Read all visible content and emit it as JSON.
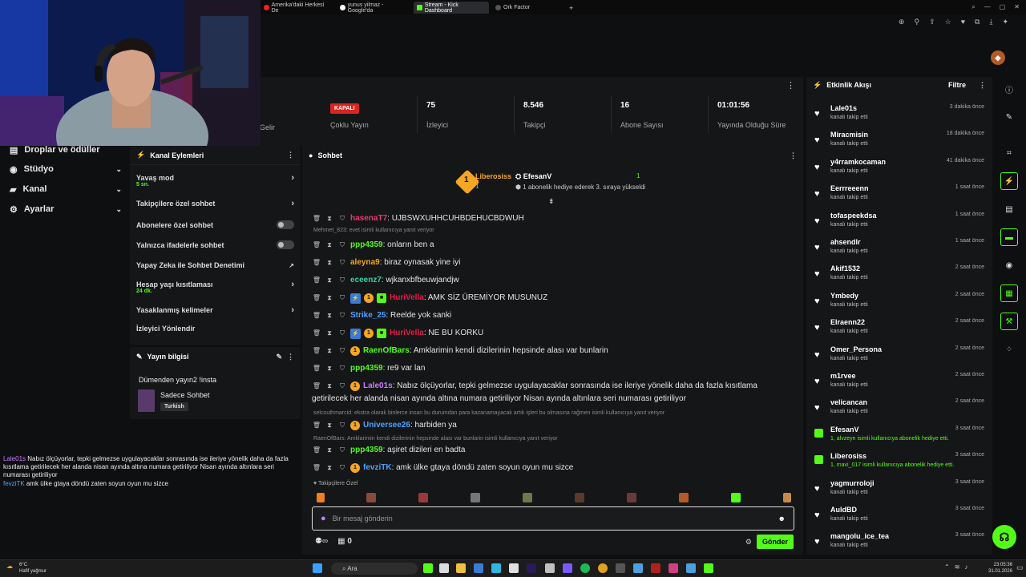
{
  "browser": {
    "tabs": [
      {
        "label": "Amerika'daki Herkesi De",
        "color": "#e22"
      },
      {
        "label": "yunus yilmaz - Google'da",
        "color": "#fff"
      },
      {
        "label": "Stream - Kick Dashboard",
        "color": "#53fc18"
      },
      {
        "label": "Ork Factor",
        "color": "#333"
      }
    ],
    "new_tab": "+"
  },
  "stats": {
    "partial_label_1": "ik Gelir",
    "live": {
      "badge": "KAPALI",
      "label": "Çoklu Yayın"
    },
    "viewers": {
      "value": "75",
      "label": "İzleyici"
    },
    "followers": {
      "value": "8.546",
      "label": "Takipçi"
    },
    "subs": {
      "value": "16",
      "label": "Abone Sayısı"
    },
    "uptime": {
      "value": "01:01:56",
      "label": "Yayında Olduğu Süre"
    }
  },
  "leftnav": {
    "items": [
      {
        "label": "Droplar ve ödüller"
      },
      {
        "label": "Stüdyo"
      },
      {
        "label": "Kanal"
      },
      {
        "label": "Ayarlar"
      }
    ]
  },
  "channel_actions": {
    "title": "Kanal Eylemleri",
    "slow_mode": {
      "label": "Yavaş mod",
      "sub": "5 sn."
    },
    "followers_only": "Takipçilere özel sohbet",
    "subs_only": "Abonelere özel sohbet",
    "emotes_only": "Yalnızca ifadelerle sohbet",
    "ai_moderation": "Yapay Zeka ile Sohbet Denetimi",
    "account_age": {
      "label": "Hesap yaşı kısıtlaması",
      "sub": "24 dk."
    },
    "banned_words": "Yasaklanmış kelimeler",
    "viewer_redirect": "İzleyici Yönlendir"
  },
  "stream_info": {
    "title": "Yayın bilgisi",
    "stream_title": "Dümenden yayın2 !insta",
    "category": "Sadece Sohbet",
    "language": "Turkish"
  },
  "chat": {
    "title": "Sohbet",
    "pinned": {
      "top1": {
        "name": "Liberosiss",
        "count": "1"
      },
      "top2": {
        "name": "EfesanV",
        "count": "1"
      },
      "note": "1 abonelik hediye ederek 3. sıraya yükseldi"
    },
    "messages": [
      {
        "user": "hasenaT7",
        "color": "#e63b6f",
        "text": ": UJBSWXUHHCUHBDEHUCBDWUH"
      },
      {
        "reply": "Mehmet_823: evet isimli kullanıcıya yanıt veriyor"
      },
      {
        "user": "ppp4359",
        "color": "#53fc18",
        "text": ": onların ben a"
      },
      {
        "user": "aleyna9",
        "color": "#f5a623",
        "text": ": biraz oynasak yine iyi"
      },
      {
        "user": "eceenz7",
        "color": "#2fd3a0",
        "text": ": wjkanxbfbeuwjandjw"
      },
      {
        "user": "HuriVella",
        "color": "#e6194b",
        "text": ": AMK SİZ ÜREMİYOR MUSUNUZ"
      },
      {
        "user": "Strike_25",
        "color": "#4aa3ff",
        "text": ": Reelde yok sanki"
      },
      {
        "user": "HuriVella",
        "color": "#e6194b",
        "text": ": NE BU KORKU"
      },
      {
        "user": "RaenOfBars",
        "color": "#53fc18",
        "text": ": Amklarimin kendi dizilerinin hepsinde alası var bunlarin"
      },
      {
        "user": "ppp4359",
        "color": "#53fc18",
        "text": ": re9 var lan"
      },
      {
        "user": "Lale01s",
        "color": "#c77dff",
        "text": ": Nabız ölçüyorlar, tepki gelmezse uygulayacaklar sonrasında ise ileriye yönelik daha da fazla kısıtlama"
      },
      {
        "cont": "getirilecek her alanda nisan ayında altına numara getiriliyor Nisan ayında altınlara seri numarası getiriliyor"
      },
      {
        "reply": "selcouthmarcid: ekstra olarak binlerce insan bu durumdan para kazanamayacak artık işleri bu olmasına rağmen isimli kullanıcıya yanıt veriyor"
      },
      {
        "user": "Universee26",
        "color": "#4aa3ff",
        "text": ": harbiden ya"
      },
      {
        "reply": "RaenOfBars: Amklarimin kendi dizilerinin hepsinde alası var bunlarin isimli kullanıcıya yanıt veriyor"
      },
      {
        "user": "ppp4359",
        "color": "#53fc18",
        "text": ": aşiret dizileri en badta"
      },
      {
        "user": "fevziTK",
        "color": "#4aa3ff",
        "text": ": amk ülke gtaya döndü zaten soyun oyun mu sizce"
      }
    ],
    "followers_emotes_label": "Takipçilere Özel",
    "input_placeholder": "Bir mesaj gönderin",
    "points": "0",
    "send": "Gönder"
  },
  "feed": {
    "title": "Etkinlik Akışı",
    "filter": "Filtre",
    "items": [
      {
        "name": "Lale01s",
        "sub": "kanalı takip etti",
        "time": "3 dakika önce",
        "type": "follow"
      },
      {
        "name": "Miracmisin",
        "sub": "kanalı takip etti",
        "time": "18 dakika önce",
        "type": "follow"
      },
      {
        "name": "y4rramkocaman",
        "sub": "kanalı takip etti",
        "time": "41 dakika önce",
        "type": "follow"
      },
      {
        "name": "Eerrreeenn",
        "sub": "kanalı takip etti",
        "time": "1 saat önce",
        "type": "follow"
      },
      {
        "name": "tofaspeekdsa",
        "sub": "kanalı takip etti",
        "time": "1 saat önce",
        "type": "follow"
      },
      {
        "name": "ahsendlr",
        "sub": "kanalı takip etti",
        "time": "1 saat önce",
        "type": "follow"
      },
      {
        "name": "Akif1532",
        "sub": "kanalı takip etti",
        "time": "2 saat önce",
        "type": "follow"
      },
      {
        "name": "Ymbedy",
        "sub": "kanalı takip etti",
        "time": "2 saat önce",
        "type": "follow"
      },
      {
        "name": "Elraenn22",
        "sub": "kanalı takip etti",
        "time": "2 saat önce",
        "type": "follow"
      },
      {
        "name": "Omer_Persona",
        "sub": "kanalı takip etti",
        "time": "2 saat önce",
        "type": "follow"
      },
      {
        "name": "m1rvee",
        "sub": "kanalı takip etti",
        "time": "2 saat önce",
        "type": "follow"
      },
      {
        "name": "velicancan",
        "sub": "kanalı takip etti",
        "time": "2 saat önce",
        "type": "follow"
      },
      {
        "name": "EfesanV",
        "sub": "1, alvzeyn isimli kullanıcıya abonelik hediye etti.",
        "time": "3 saat önce",
        "type": "gift"
      },
      {
        "name": "Liberosiss",
        "sub": "1, mavi_017 isimli kullanıcıya abonelik hediye etti.",
        "time": "3 saat önce",
        "type": "gift"
      },
      {
        "name": "yagmurroloji",
        "sub": "kanalı takip etti",
        "time": "3 saat önce",
        "type": "follow"
      },
      {
        "name": "AuldBD",
        "sub": "kanalı takip etti",
        "time": "3 saat önce",
        "type": "follow"
      },
      {
        "name": "mangolu_ice_tea",
        "sub": "kanalı takip etti",
        "time": "3 saat önce",
        "type": "follow"
      }
    ]
  },
  "overlay": [
    {
      "user": "Lale01s",
      "text": "Nabız ölçüyorlar, tepki gelmezse uygulayacaklar sonrasında ise ileriye yönelik daha da fazla kısıtlama getirilecek her alanda nisan ayında altına numara getiriliyor Nisan ayında altınlara seri numarası getiriliyor"
    },
    {
      "user": "fevziTK",
      "text": "amk ülke gtaya döndü zaten soyun oyun mu sizce"
    }
  ],
  "taskbar": {
    "weather_temp": "6°C",
    "weather_desc": "Hafif yağmur",
    "search": "Ara",
    "time": "23:05:36",
    "date": "31.01.2026"
  },
  "colors": {
    "accent": "#53fc18",
    "live_red": "#d9241f"
  }
}
